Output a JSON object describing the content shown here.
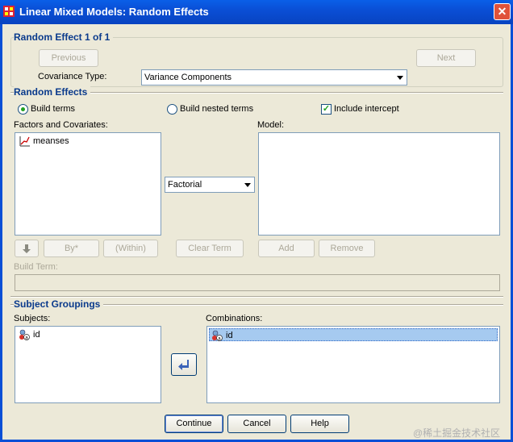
{
  "window": {
    "title": "Linear Mixed Models: Random Effects",
    "close_glyph": "✕"
  },
  "effect_group": {
    "heading": "Random Effect 1 of 1",
    "previous_label": "Previous",
    "next_label": "Next",
    "covariance_label": "Covariance Type:",
    "covariance_value": "Variance Components"
  },
  "random_effects": {
    "heading": "Random Effects",
    "build_terms_label": "Build terms",
    "build_nested_label": "Build nested terms",
    "include_intercept_label": "Include intercept",
    "include_intercept_checked": true,
    "factors_label": "Factors and Covariates:",
    "factors": [
      {
        "name": "meanses",
        "icon": "scale-variable-icon"
      }
    ],
    "term_type": "Factorial",
    "model_label": "Model:",
    "model_items": [],
    "by_label": "By*",
    "within_label": "(Within)",
    "clear_term_label": "Clear Term",
    "add_label": "Add",
    "remove_label": "Remove",
    "build_term_label": "Build Term:"
  },
  "subject_groupings": {
    "heading": "Subject Groupings",
    "subjects_label": "Subjects:",
    "subjects": [
      {
        "name": "id",
        "icon": "nominal-variable-icon"
      }
    ],
    "combinations_label": "Combinations:",
    "combinations": [
      {
        "name": "id",
        "icon": "nominal-variable-icon",
        "selected": true
      }
    ]
  },
  "footer": {
    "continue_label": "Continue",
    "cancel_label": "Cancel",
    "help_label": "Help"
  },
  "watermark": "@稀土掘金技术社区",
  "colors": {
    "title_bar": "#0a4fd6",
    "heading_text": "#0a3a8c",
    "dialog_bg": "#ece9d8",
    "selection": "#a6caf0"
  }
}
